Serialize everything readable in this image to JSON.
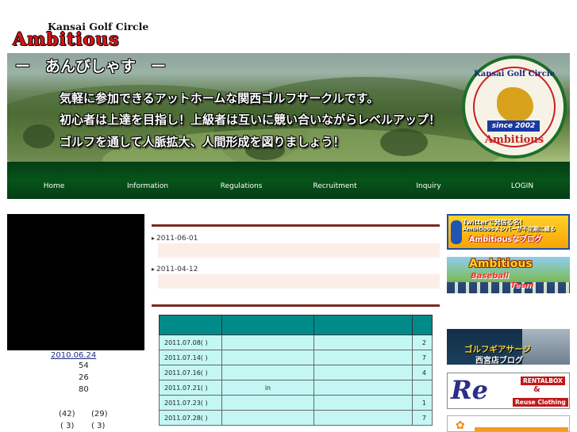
{
  "header": {
    "logo_top": "Kansai Golf Circle",
    "logo_main": "Ambitious"
  },
  "banner": {
    "title": "ー　あんびしゃす　ー",
    "taglines": [
      "気軽に参加できるアットホームな関西ゴルフサークルです。",
      "初心者は上達を目指し！上級者は互いに競い合いながらレベルアップ！",
      "ゴルフを通して人脈拡大、人間形成を図りましょう！"
    ],
    "emblem": {
      "top": "Kansai Golf Circle",
      "since": "since 2002",
      "bottom": "Ambitious"
    }
  },
  "nav": {
    "items": [
      "Home",
      "Information",
      "Regulations",
      "Recruitment",
      "Inquiry",
      "LOGIN"
    ]
  },
  "left": {
    "date": "2010.06.24",
    "counts": [
      "54",
      "26",
      "80"
    ],
    "pair1": [
      "(42)",
      "(29)"
    ],
    "pair2": [
      "( 3)",
      "( 3)"
    ]
  },
  "news": [
    {
      "date": "2011-06-01"
    },
    {
      "date": "2011-04-12"
    }
  ],
  "schedule": {
    "rows": [
      {
        "date": "2011.07.08( )",
        "note": "",
        "count": "2"
      },
      {
        "date": "2011.07.14( )",
        "note": "",
        "count": "7"
      },
      {
        "date": "2011.07.16( )",
        "note": "",
        "count": "4"
      },
      {
        "date": "2011.07.21( )",
        "note": "in",
        "count": ""
      },
      {
        "date": "2011.07.23( )",
        "note": "",
        "count": "1"
      },
      {
        "date": "2011.07.28( )",
        "note": "",
        "count": "7"
      }
    ]
  },
  "right_banners": {
    "blog": {
      "line1": "Twitterで発信る名！",
      "line1b": "Ambitiousメンバーが不定期に綴る",
      "line2": "Ambitiousなブログ"
    },
    "baseball": {
      "title": "Ambitious",
      "sub1": "Baseball",
      "sub2": "Team"
    },
    "shop": {
      "line1": "ゴルフギアサージ",
      "line2": "西宮店ブログ"
    },
    "rental": {
      "logo": "Re",
      "label1": "RENTALBOX",
      "amp": "&",
      "label2": "Reuse Clothing"
    }
  },
  "colors": {
    "nav_bg": "#065419",
    "accent_red": "#7a2a1e",
    "table_header": "#008a8a",
    "table_cell": "#c4f7f3",
    "news_band": "#fbeee8",
    "logo_red": "#d81414"
  }
}
